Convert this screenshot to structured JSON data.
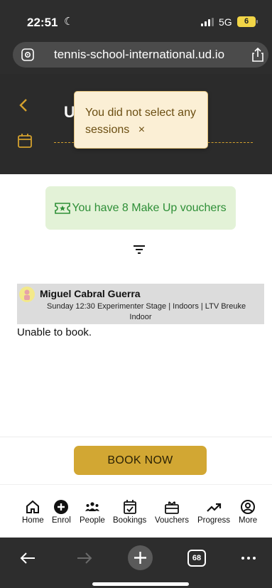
{
  "status_bar": {
    "time": "22:51",
    "network": "5G",
    "battery": "6"
  },
  "browser": {
    "url": "tennis-school-international.ud.io",
    "tab_count": "68"
  },
  "header": {
    "title": "U              ERS"
  },
  "toast": {
    "message": "You did not select any sessions",
    "close": "×"
  },
  "vouchers": {
    "text": "You have 8 Make Up vouchers"
  },
  "session": {
    "name": "Miguel Cabral Guerra",
    "detail": "Sunday 12:30 Experimenter Stage | Indoors | LTV Breuke",
    "location": "Indoor",
    "status": "Unable to book."
  },
  "book_button": {
    "label": "BOOK NOW"
  },
  "nav": [
    {
      "label": "Home",
      "icon": "home-icon"
    },
    {
      "label": "Enrol",
      "icon": "plus-circle-icon"
    },
    {
      "label": "People",
      "icon": "people-icon"
    },
    {
      "label": "Bookings",
      "icon": "calendar-check-icon"
    },
    {
      "label": "Vouchers",
      "icon": "voucher-icon"
    },
    {
      "label": "Progress",
      "icon": "trend-icon"
    },
    {
      "label": "More",
      "icon": "more-icon"
    }
  ],
  "colors": {
    "accent": "#d2a733",
    "success": "#2e8f37",
    "toast_bg": "#fbefd5",
    "header_bg": "#2b2b2b"
  }
}
